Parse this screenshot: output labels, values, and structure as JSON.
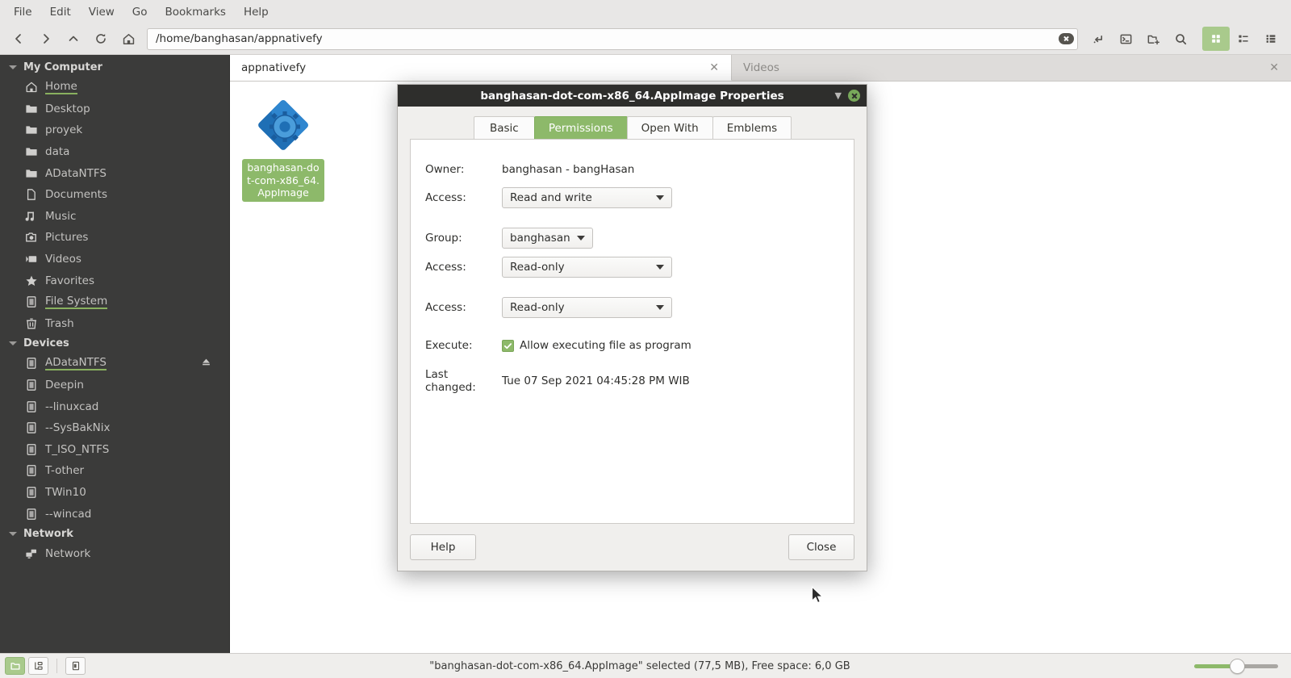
{
  "menubar": {
    "items": [
      {
        "label": "File"
      },
      {
        "label": "Edit"
      },
      {
        "label": "View"
      },
      {
        "label": "Go"
      },
      {
        "label": "Bookmarks"
      },
      {
        "label": "Help"
      }
    ]
  },
  "toolbar": {
    "back_icon": "chevron-left-icon",
    "forward_icon": "chevron-right-icon",
    "up_icon": "chevron-up-icon",
    "reload_icon": "reload-icon",
    "home_icon": "home-icon",
    "address_value": "/home/banghasan/appnativefy",
    "clear_icon": "clear-icon",
    "split_icon": "split-view-icon",
    "terminal_icon": "terminal-icon",
    "new_folder_icon": "new-folder-icon",
    "search_icon": "search-icon",
    "icon_view_icon": "grid-view-icon",
    "list_view_icon": "list-view-icon",
    "compact_view_icon": "compact-view-icon"
  },
  "sidebar": {
    "groups": [
      {
        "title": "My Computer",
        "items": [
          {
            "label": "Home",
            "icon": "home-icon",
            "selected": true,
            "eject": false
          },
          {
            "label": "Desktop",
            "icon": "folder-icon",
            "selected": false,
            "eject": false
          },
          {
            "label": "proyek",
            "icon": "folder-icon",
            "selected": false,
            "eject": false
          },
          {
            "label": "data",
            "icon": "folder-icon",
            "selected": false,
            "eject": false
          },
          {
            "label": "ADataNTFS",
            "icon": "folder-icon",
            "selected": false,
            "eject": false
          },
          {
            "label": "Documents",
            "icon": "document-icon",
            "selected": false,
            "eject": false
          },
          {
            "label": "Music",
            "icon": "music-icon",
            "selected": false,
            "eject": false
          },
          {
            "label": "Pictures",
            "icon": "camera-icon",
            "selected": false,
            "eject": false
          },
          {
            "label": "Videos",
            "icon": "video-icon",
            "selected": false,
            "eject": false
          },
          {
            "label": "Favorites",
            "icon": "star-icon",
            "selected": false,
            "eject": false
          },
          {
            "label": "File System",
            "icon": "drive-icon",
            "selected": true,
            "eject": false
          },
          {
            "label": "Trash",
            "icon": "trash-icon",
            "selected": false,
            "eject": false
          }
        ]
      },
      {
        "title": "Devices",
        "items": [
          {
            "label": "ADataNTFS",
            "icon": "drive-icon",
            "selected": true,
            "eject": true
          },
          {
            "label": "Deepin",
            "icon": "drive-icon",
            "selected": false,
            "eject": false
          },
          {
            "label": "--linuxcad",
            "icon": "drive-icon",
            "selected": false,
            "eject": false
          },
          {
            "label": "--SysBakNix",
            "icon": "drive-icon",
            "selected": false,
            "eject": false
          },
          {
            "label": "T_ISO_NTFS",
            "icon": "drive-icon",
            "selected": false,
            "eject": false
          },
          {
            "label": "T-other",
            "icon": "drive-icon",
            "selected": false,
            "eject": false
          },
          {
            "label": "TWin10",
            "icon": "drive-icon",
            "selected": false,
            "eject": false
          },
          {
            "label": "--wincad",
            "icon": "drive-icon",
            "selected": false,
            "eject": false
          }
        ]
      },
      {
        "title": "Network",
        "items": [
          {
            "label": "Network",
            "icon": "network-icon",
            "selected": false,
            "eject": false
          }
        ]
      }
    ]
  },
  "tabs": [
    {
      "label": "appnativefy",
      "active": true,
      "close_icon": "close-icon"
    },
    {
      "label": "Videos",
      "active": false,
      "close_icon": "close-icon"
    }
  ],
  "files": [
    {
      "name": "banghasan-dot-com-x86_64.AppImage",
      "icon": "appimage-icon",
      "selected": true
    }
  ],
  "dialog": {
    "title": "banghasan-dot-com-x86_64.AppImage Properties",
    "shade_icon": "chevron-down-icon",
    "close_icon": "close-icon",
    "tabs": [
      {
        "label": "Basic",
        "active": false
      },
      {
        "label": "Permissions",
        "active": true
      },
      {
        "label": "Open With",
        "active": false
      },
      {
        "label": "Emblems",
        "active": false
      }
    ],
    "fields": {
      "owner_label": "Owner:",
      "owner_value": "banghasan - bangHasan",
      "owner_access_label": "Access:",
      "owner_access_value": "Read and write",
      "group_label": "Group:",
      "group_value": "banghasan",
      "group_access_label": "Access:",
      "group_access_value": "Read-only",
      "other_access_label": "Access:",
      "other_access_value": "Read-only",
      "execute_label": "Execute:",
      "execute_checkbox_label": "Allow executing file as program",
      "execute_checked": true,
      "last_changed_label": "Last changed:",
      "last_changed_value": "Tue 07 Sep 2021 04:45:28 PM WIB"
    },
    "help_label": "Help",
    "close_label": "Close"
  },
  "statusbar": {
    "icon_view_icon": "folder-view-icon",
    "tree_view_icon": "tree-view-icon",
    "pane_icon": "side-pane-icon",
    "status_text": "\"banghasan-dot-com-x86_64.AppImage\" selected (77,5 MB), Free space: 6,0 GB"
  },
  "colors": {
    "accent_green": "#8db96a",
    "sidebar_bg": "#3b3b3a",
    "titlebar_bg": "#2e2e2c",
    "toolbar_bg": "#e8e7e6"
  }
}
